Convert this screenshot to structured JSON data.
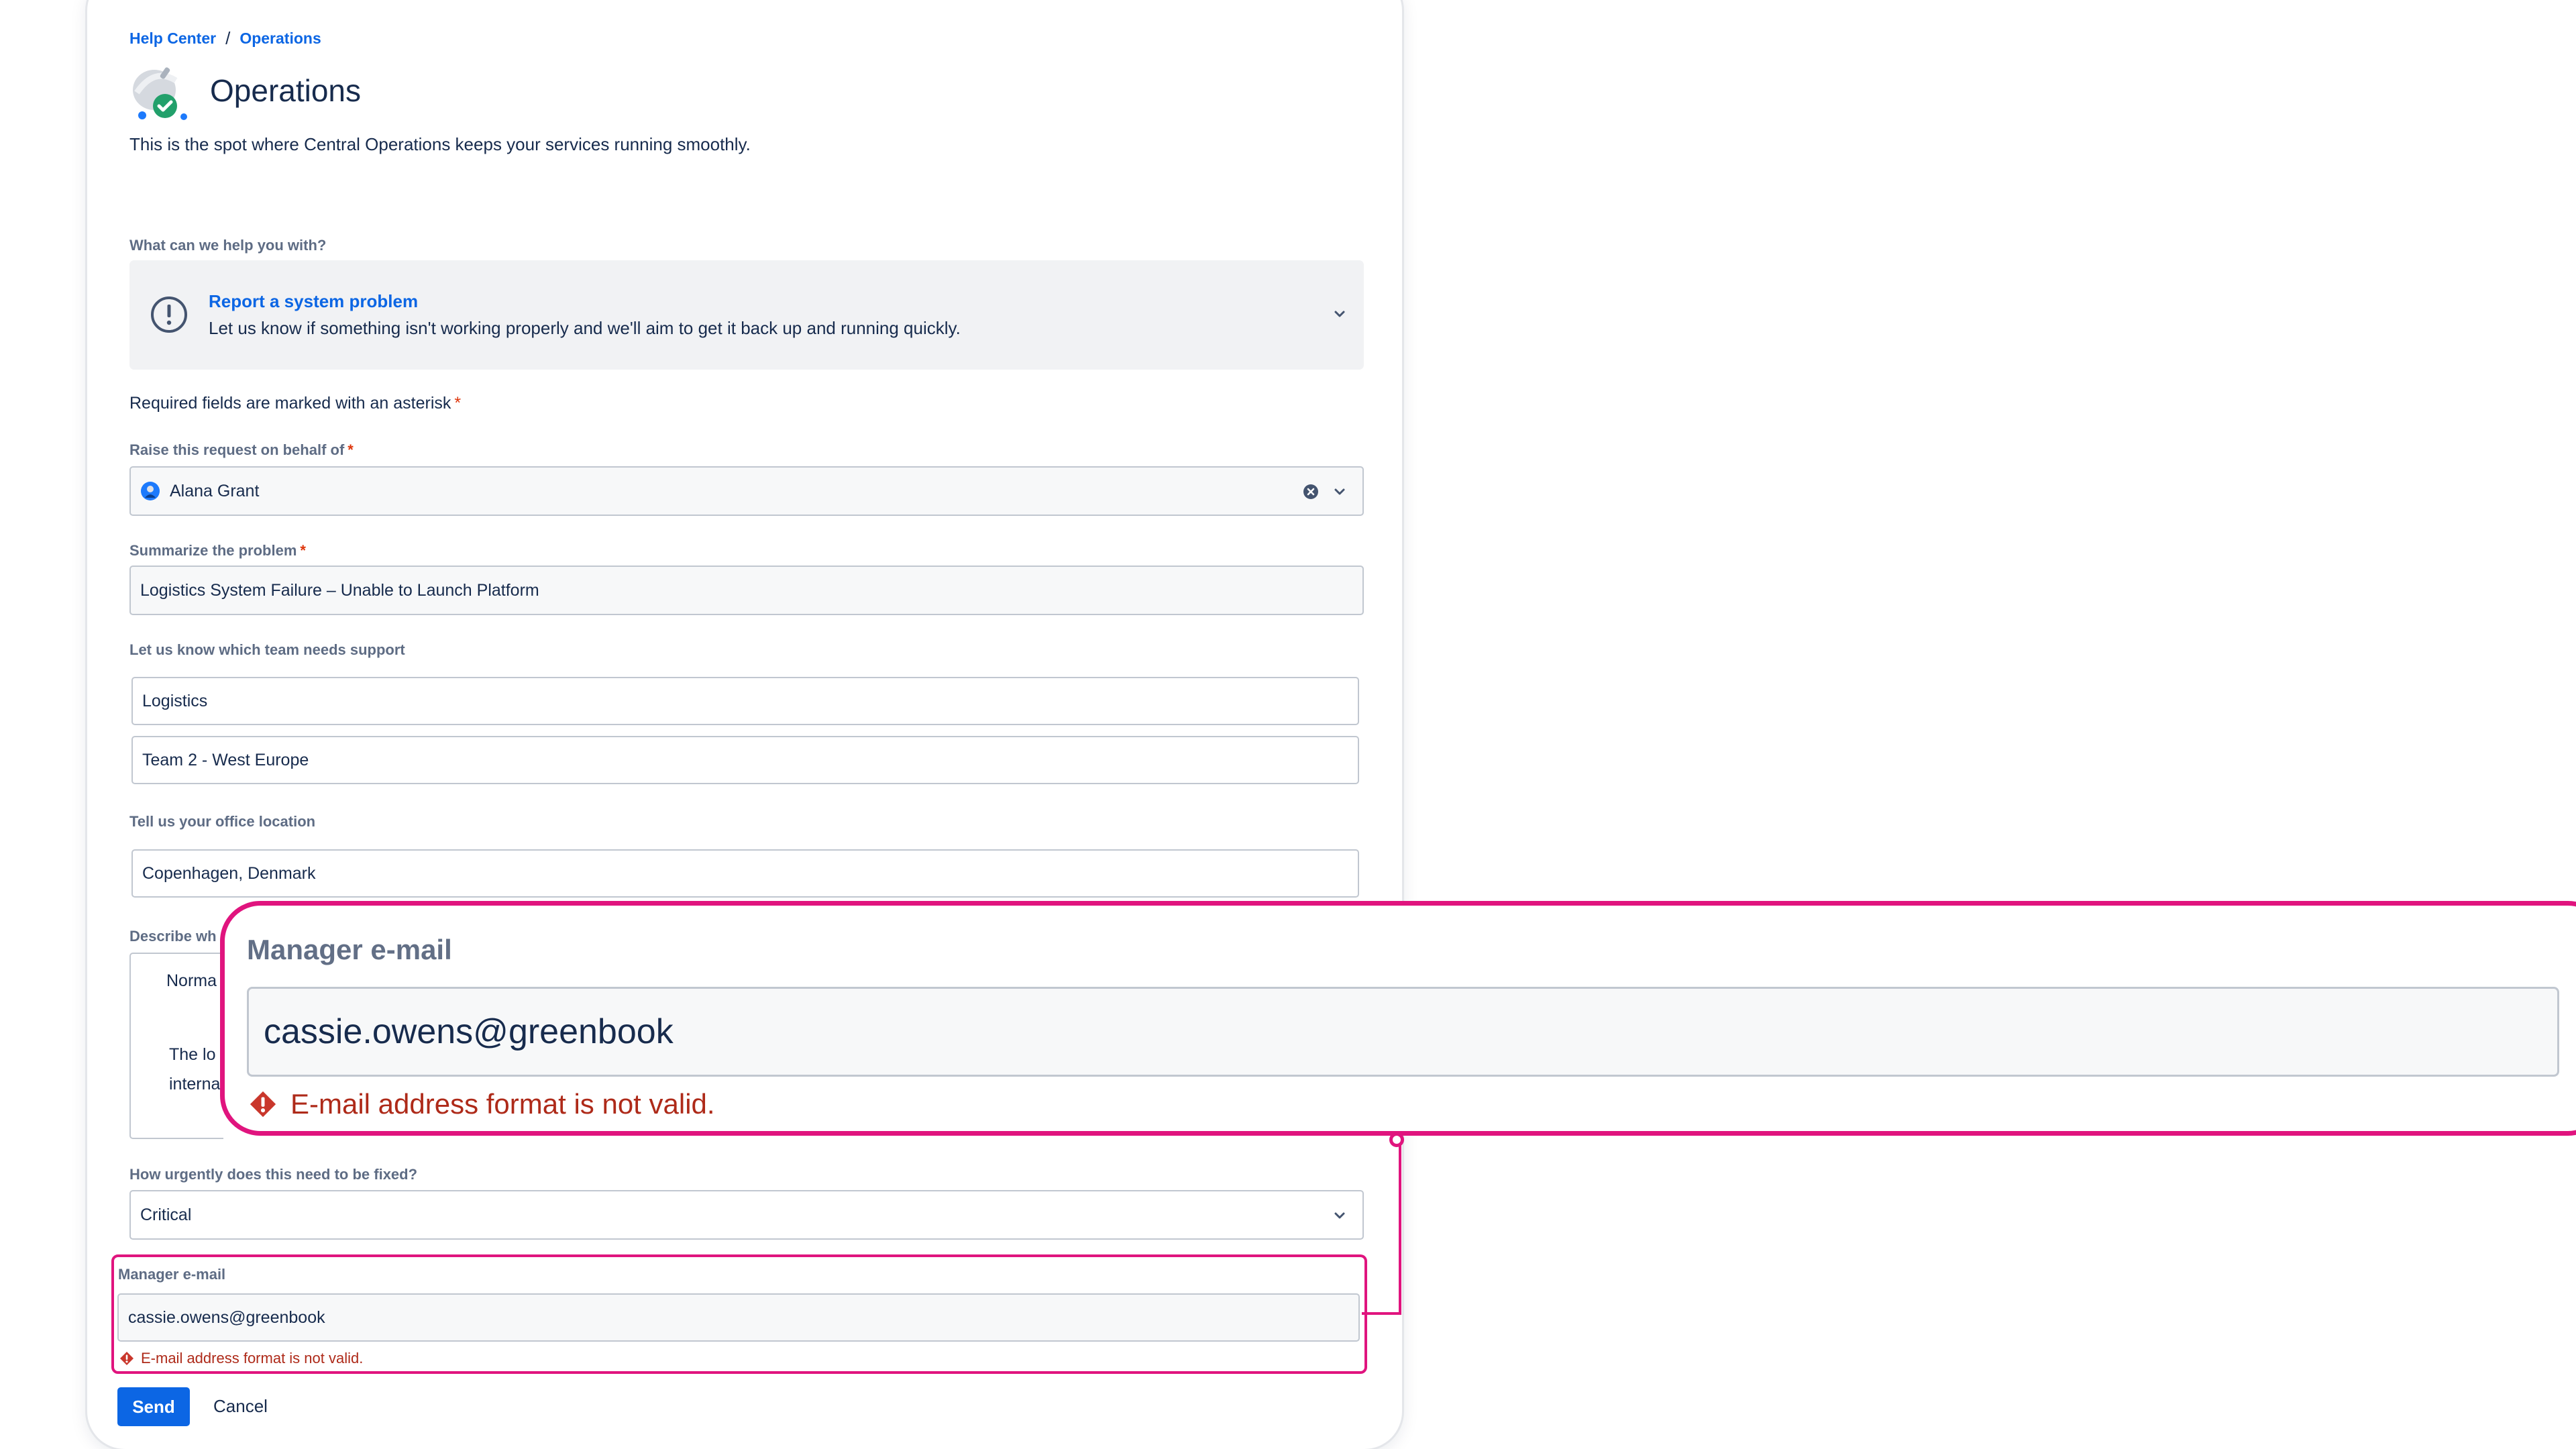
{
  "breadcrumb": {
    "root": "Help Center",
    "separator": "/",
    "current": "Operations"
  },
  "header": {
    "title": "Operations",
    "subtitle": "This is the spot where Central Operations keeps your services running smoothly.",
    "logo_icon": "operations-satellite-icon"
  },
  "request_type": {
    "question": "What can we help you with?",
    "title": "Report a system problem",
    "description": "Let us know if something isn't working properly and we'll aim to get it back up and running quickly.",
    "icon": "alert-circle-icon"
  },
  "required_note": "Required fields are marked with an asterisk",
  "required_marker": "*",
  "fields": {
    "behalf": {
      "label": "Raise this request on behalf of",
      "value": "Alana Grant"
    },
    "summary": {
      "label": "Summarize the problem",
      "value": "Logistics System Failure – Unable to Launch Platform"
    },
    "team": {
      "label": "Let us know which team needs support",
      "value1": "Logistics",
      "value2": "Team 2 - West Europe"
    },
    "office": {
      "label": "Tell us your office location",
      "value": "Copenhagen, Denmark"
    },
    "describe": {
      "label_partial": "Describe wh",
      "toolbar_partial": "Norma",
      "text_partial1": "The lo",
      "text_partial2": "interna"
    },
    "urgency": {
      "label": "How urgently does this need to be fixed?",
      "value": "Critical"
    },
    "manager_email": {
      "label": "Manager e-mail",
      "value": "cassie.owens@greenbook",
      "error": "E-mail address format is not valid."
    }
  },
  "actions": {
    "send": "Send",
    "cancel": "Cancel"
  },
  "colors": {
    "highlight": "#e0147e",
    "primary": "#0c66e4",
    "error": "#ae2a19",
    "required": "#de350b"
  }
}
